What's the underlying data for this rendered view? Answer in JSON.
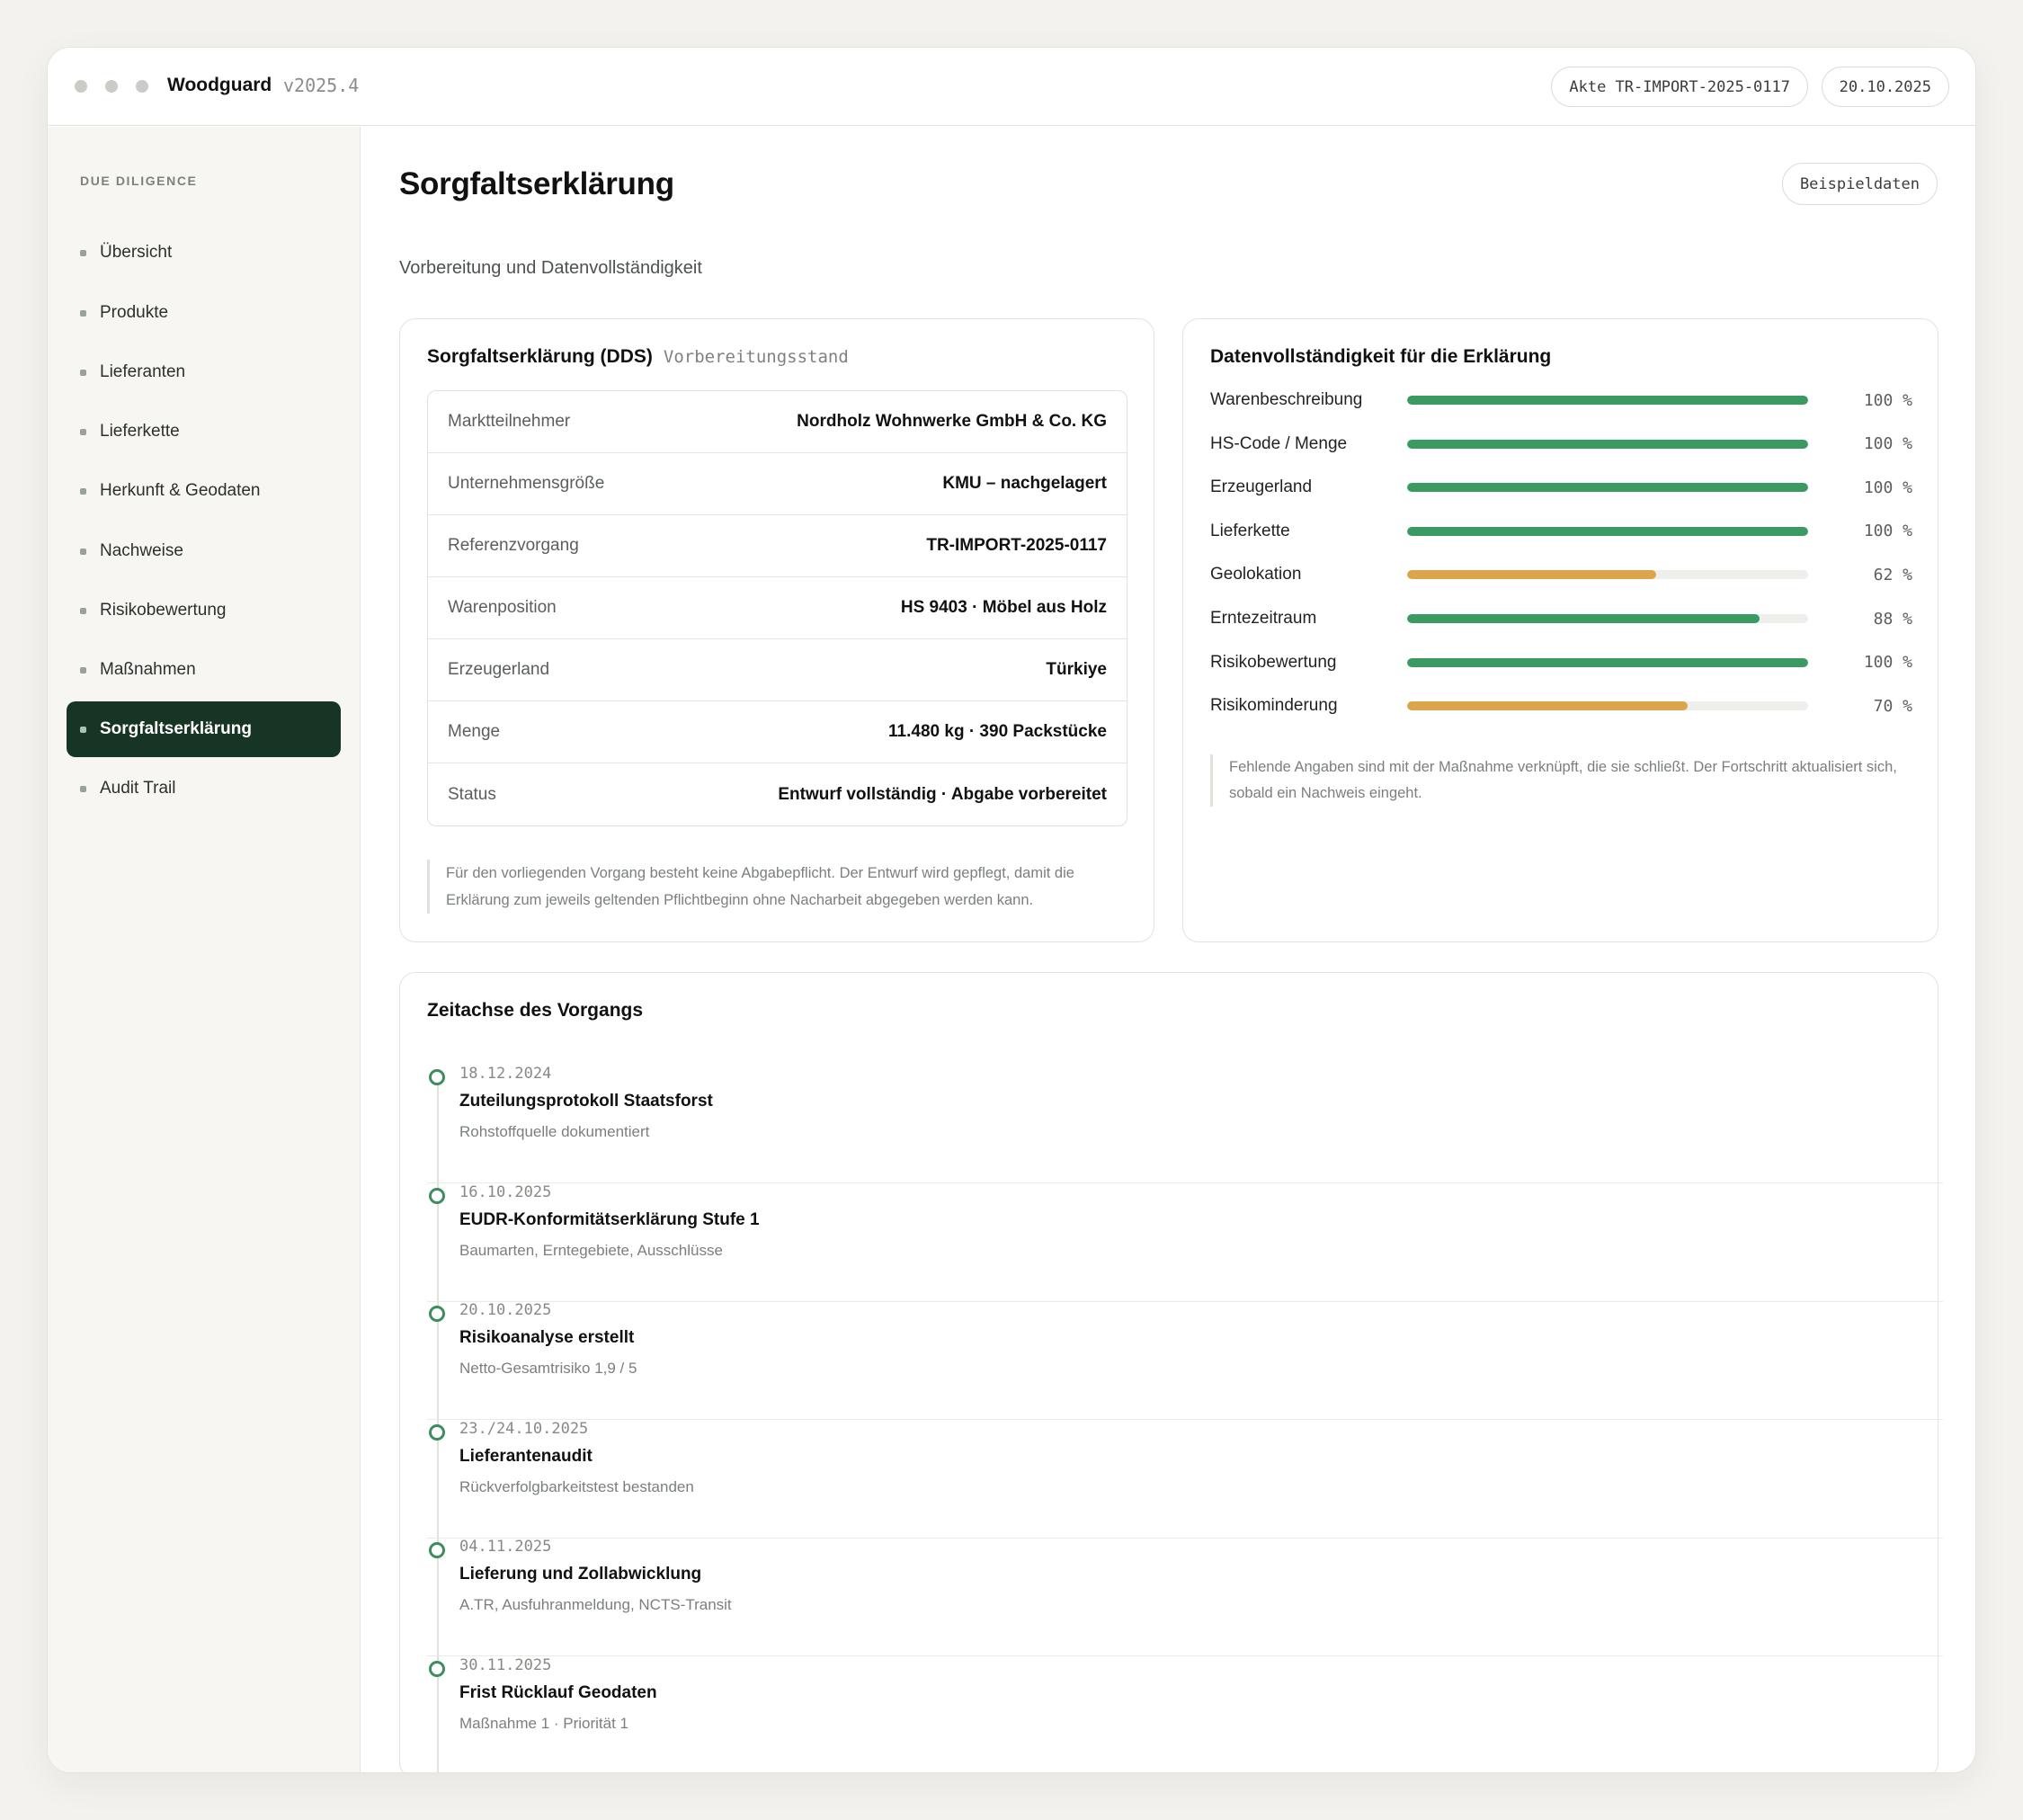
{
  "titlebar": {
    "app_name": "Woodguard",
    "version": "v2025.4",
    "file_label": "Akte TR-IMPORT-2025-0117",
    "date": "20.10.2025"
  },
  "sidebar": {
    "heading": "DUE DILIGENCE",
    "items": [
      {
        "label": "Übersicht"
      },
      {
        "label": "Produkte"
      },
      {
        "label": "Lieferanten"
      },
      {
        "label": "Lieferkette"
      },
      {
        "label": "Herkunft & Geodaten"
      },
      {
        "label": "Nachweise"
      },
      {
        "label": "Risikobewertung"
      },
      {
        "label": "Maßnahmen"
      },
      {
        "label": "Sorgfaltserklärung",
        "active": true
      },
      {
        "label": "Audit Trail"
      }
    ]
  },
  "header": {
    "title": "Sorgfaltserklärung",
    "subtitle": "Vorbereitung und Datenvollständigkeit",
    "sample_button": "Beispieldaten"
  },
  "dds_card": {
    "title": "Sorgfaltserklärung (DDS)",
    "tag": "Vorbereitungsstand",
    "rows": [
      {
        "label": "Marktteilnehmer",
        "value": "Nordholz Wohnwerke GmbH & Co. KG"
      },
      {
        "label": "Unternehmensgröße",
        "value": "KMU – nachgelagert"
      },
      {
        "label": "Referenzvorgang",
        "value": "TR-IMPORT-2025-0117"
      },
      {
        "label": "Warenposition",
        "value": "HS 9403 · Möbel aus Holz"
      },
      {
        "label": "Erzeugerland",
        "value": "Türkiye"
      },
      {
        "label": "Menge",
        "value": "11.480 kg · 390 Packstücke"
      },
      {
        "label": "Status",
        "value": "Entwurf vollständig · Abgabe vorbereitet"
      }
    ],
    "note": "Für den vorliegenden Vorgang besteht keine Abgabepflicht. Der Entwurf wird gepflegt, damit die Erklärung zum jeweils geltenden Pflichtbeginn ohne Nacharbeit abgegeben werden kann."
  },
  "completeness_card": {
    "title": "Datenvollständigkeit für die Erklärung",
    "colors": {
      "complete": "#3a9a62",
      "partial": "#dca54a",
      "track": "#eeeeea"
    },
    "items": [
      {
        "label": "Warenbeschreibung",
        "value": 100,
        "pct_text": "100 %",
        "status": "complete"
      },
      {
        "label": "HS-Code / Menge",
        "value": 100,
        "pct_text": "100 %",
        "status": "complete"
      },
      {
        "label": "Erzeugerland",
        "value": 100,
        "pct_text": "100 %",
        "status": "complete"
      },
      {
        "label": "Lieferkette",
        "value": 100,
        "pct_text": "100 %",
        "status": "complete"
      },
      {
        "label": "Geolokation",
        "value": 62,
        "pct_text": "62 %",
        "status": "partial"
      },
      {
        "label": "Erntezeitraum",
        "value": 88,
        "pct_text": "88 %",
        "status": "complete"
      },
      {
        "label": "Risikobewertung",
        "value": 100,
        "pct_text": "100 %",
        "status": "complete"
      },
      {
        "label": "Risikominderung",
        "value": 70,
        "pct_text": "70 %",
        "status": "partial"
      }
    ],
    "note": "Fehlende Angaben sind mit der Maßnahme verknüpft, die sie schließt. Der Fortschritt aktualisiert sich, sobald ein Nachweis eingeht."
  },
  "timeline_card": {
    "title": "Zeitachse des Vorgangs",
    "events": [
      {
        "date": "18.12.2024",
        "title": "Zuteilungsprotokoll Staatsforst",
        "desc": "Rohstoffquelle dokumentiert"
      },
      {
        "date": "16.10.2025",
        "title": "EUDR-Konformitätserklärung Stufe 1",
        "desc": "Baumarten, Erntegebiete, Ausschlüsse"
      },
      {
        "date": "20.10.2025",
        "title": "Risikoanalyse erstellt",
        "desc": "Netto-Gesamtrisiko 1,9 / 5"
      },
      {
        "date": "23./24.10.2025",
        "title": "Lieferantenaudit",
        "desc": "Rückverfolgbarkeitstest bestanden"
      },
      {
        "date": "04.11.2025",
        "title": "Lieferung und Zollabwicklung",
        "desc": "A.TR, Ausfuhranmeldung, NCTS-Transit"
      },
      {
        "date": "30.11.2025",
        "title": "Frist Rücklauf Geodaten",
        "desc": "Maßnahme 1 · Priorität 1"
      }
    ]
  }
}
